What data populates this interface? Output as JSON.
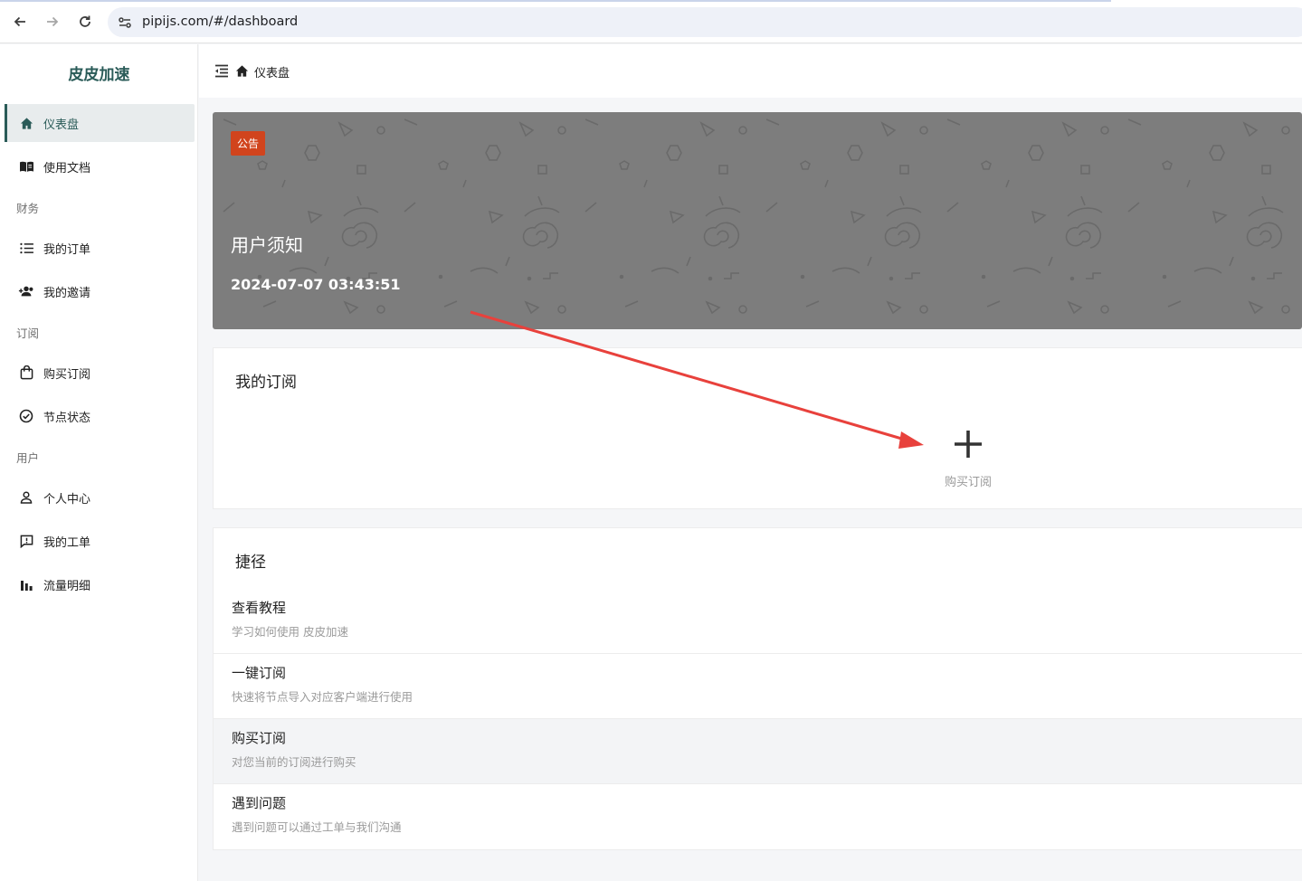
{
  "browser": {
    "url": "pipijs.com/#/dashboard"
  },
  "sidebar": {
    "brand": "皮皮加速",
    "items": [
      {
        "label": "仪表盘",
        "icon": "home-icon",
        "active": true
      },
      {
        "label": "使用文档",
        "icon": "book-icon"
      },
      {
        "group": "财务"
      },
      {
        "label": "我的订单",
        "icon": "list-icon"
      },
      {
        "label": "我的邀请",
        "icon": "user-add-icon"
      },
      {
        "group": "订阅"
      },
      {
        "label": "购买订阅",
        "icon": "shopping-bag-icon"
      },
      {
        "label": "节点状态",
        "icon": "check-circle-icon"
      },
      {
        "group": "用户"
      },
      {
        "label": "个人中心",
        "icon": "person-icon"
      },
      {
        "label": "我的工单",
        "icon": "ticket-icon"
      },
      {
        "label": "流量明细",
        "icon": "bar-chart-icon"
      }
    ]
  },
  "header": {
    "breadcrumb": "仪表盘"
  },
  "notice": {
    "badge": "公告",
    "title": "用户须知",
    "time": "2024-07-07 03:43:51"
  },
  "subscriptions": {
    "title": "我的订阅",
    "add_label": "购买订阅"
  },
  "shortcuts": {
    "title": "捷径",
    "items": [
      {
        "title": "查看教程",
        "desc": "学习如何使用 皮皮加速"
      },
      {
        "title": "一键订阅",
        "desc": "快速将节点导入对应客户端进行使用"
      },
      {
        "title": "购买订阅",
        "desc": "对您当前的订阅进行购买"
      },
      {
        "title": "遇到问题",
        "desc": "遇到问题可以通过工单与我们沟通"
      }
    ]
  },
  "colors": {
    "brand": "#2a5b58",
    "badge": "#d1441d",
    "banner": "#7d7d7d",
    "annotation_arrow": "#e8413c"
  }
}
